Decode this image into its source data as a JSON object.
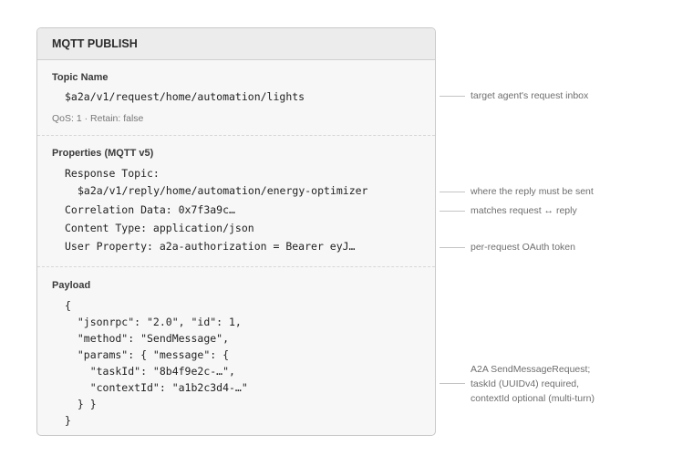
{
  "packet": {
    "header": "MQTT PUBLISH",
    "topic": {
      "title": "Topic Name",
      "value": "$a2a/v1/request/home/automation/lights",
      "meta": "QoS: 1 · Retain: false"
    },
    "properties": {
      "title": "Properties (MQTT v5)",
      "response_topic_label": "Response Topic:",
      "response_topic_value": "$a2a/v1/reply/home/automation/energy-optimizer",
      "correlation": "Correlation Data: 0x7f3a9c…",
      "content_type": "Content Type: application/json",
      "user_property": "User Property: a2a-authorization = Bearer eyJ…"
    },
    "payload": {
      "title": "Payload",
      "lines": [
        "{",
        "  \"jsonrpc\": \"2.0\", \"id\": 1,",
        "  \"method\": \"SendMessage\",",
        "  \"params\": { \"message\": {",
        "    \"taskId\": \"8b4f9e2c-…\",",
        "    \"contextId\": \"a1b2c3d4-…\"",
        "  } }",
        "}"
      ]
    }
  },
  "annotations": {
    "topic": "target agent's request inbox",
    "response_topic": "where the reply must be sent",
    "correlation": "matches request ↔ reply",
    "user_property": "per-request OAuth token",
    "payload_line1": "A2A SendMessageRequest;",
    "payload_line2": "taskId (UUIDv4) required,",
    "payload_line3": "contextId optional (multi-turn)"
  }
}
